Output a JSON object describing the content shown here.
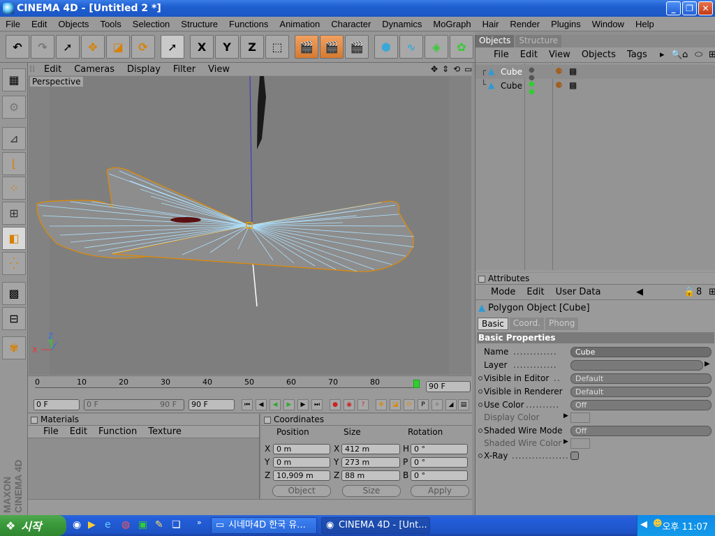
{
  "window": {
    "title": "CINEMA 4D - [Untitled 2 *]"
  },
  "menubar": [
    "File",
    "Edit",
    "Objects",
    "Tools",
    "Selection",
    "Structure",
    "Functions",
    "Animation",
    "Character",
    "Dynamics",
    "MoGraph",
    "Hair",
    "Render",
    "Plugins",
    "Window",
    "Help"
  ],
  "toolbar": {
    "axis_labels": [
      "X",
      "Y",
      "Z"
    ]
  },
  "viewport": {
    "menu": [
      "Edit",
      "Cameras",
      "Display",
      "Filter",
      "View"
    ],
    "label": "Perspective",
    "axis_x": "X",
    "axis_y": "Y",
    "axis_z": "Z"
  },
  "timeline": {
    "ticks": [
      "0",
      "10",
      "20",
      "30",
      "40",
      "50",
      "60",
      "70",
      "80"
    ],
    "end_frame": "90 F",
    "current_frame": "0 F",
    "range_start": "0 F",
    "range_end": "90 F",
    "max_frame": "90 F"
  },
  "materials": {
    "title": "Materials",
    "menu": [
      "File",
      "Edit",
      "Function",
      "Texture"
    ]
  },
  "coordinates": {
    "title": "Coordinates",
    "headers": [
      "Position",
      "Size",
      "Rotation"
    ],
    "rows": [
      {
        "pos_axis": "X",
        "pos": "0 m",
        "size_axis": "X",
        "size": "412 m",
        "rot_axis": "H",
        "rot": "0 °"
      },
      {
        "pos_axis": "Y",
        "pos": "0 m",
        "size_axis": "Y",
        "size": "273 m",
        "rot_axis": "P",
        "rot": "0 °"
      },
      {
        "pos_axis": "Z",
        "pos": "10,909 m",
        "size_axis": "Z",
        "size": "88 m",
        "rot_axis": "B",
        "rot": "0 °"
      }
    ],
    "mode_select": "Object",
    "size_select": "Size",
    "apply": "Apply"
  },
  "objects_panel": {
    "tabs": [
      "Objects",
      "Structure"
    ],
    "menu": [
      "File",
      "Edit",
      "View",
      "Objects",
      "Tags"
    ],
    "items": [
      {
        "name": "Cube"
      },
      {
        "name": "Cube"
      }
    ]
  },
  "attributes_panel": {
    "title": "Attributes",
    "menu": [
      "Mode",
      "Edit",
      "User Data"
    ],
    "object_title": "Polygon Object [Cube]",
    "tabs": [
      "Basic",
      "Coord.",
      "Phong"
    ],
    "section": "Basic Properties",
    "fields": [
      {
        "label": "Name",
        "value": "Cube"
      },
      {
        "label": "Layer",
        "value": ""
      },
      {
        "label": "Visible in Editor",
        "value": "Default"
      },
      {
        "label": "Visible in Renderer",
        "value": "Default"
      },
      {
        "label": "Use Color",
        "value": "Off"
      },
      {
        "label": "Display Color",
        "value": ""
      },
      {
        "label": "Shaded Wire Mode",
        "value": "Off"
      },
      {
        "label": "Shaded Wire Color",
        "value": ""
      },
      {
        "label": "X-Ray",
        "value": ""
      }
    ]
  },
  "brand": "MAXON CINEMA 4D",
  "taskbar": {
    "start": "시작",
    "tasks": [
      "시네마4D 한국 유...",
      "CINEMA 4D - [Unt..."
    ],
    "clock": "오후 11:07"
  }
}
